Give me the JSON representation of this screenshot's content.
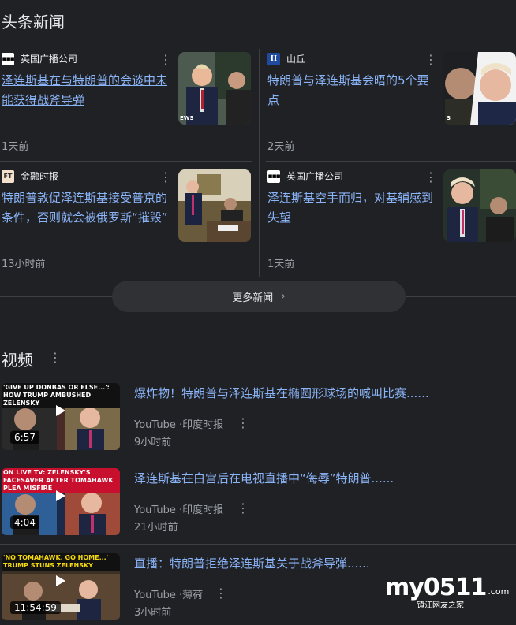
{
  "top_news": {
    "title": "头条新闻",
    "cards": [
      {
        "source": "英国广播公司",
        "favicon": "bbc-icon",
        "title": "泽连斯基在与特朗普的会谈中未能获得战斧导弹",
        "time": "1天前",
        "thumb_label": "EWS"
      },
      {
        "source": "山丘",
        "favicon": "the-hill-icon",
        "title": "特朗普与泽连斯基会晤的5个要点",
        "time": "2天前",
        "thumb_label": "S"
      },
      {
        "source": "金融时报",
        "favicon": "ft-icon",
        "favicon_text": "FT",
        "title": "特朗普敦促泽连斯基接受普京的条件，否则就会被俄罗斯“摧毁”",
        "time": "13小时前"
      },
      {
        "source": "英国广播公司",
        "favicon": "bbc-icon",
        "title": "泽连斯基空手而归，对基辅感到失望",
        "time": "1天前"
      }
    ],
    "more_label": "更多新闻"
  },
  "videos": {
    "title": "视频",
    "items": [
      {
        "title": "爆炸物！特朗普与泽连斯基在椭圆形球场的喊叫比赛......",
        "source": "YouTube",
        "channel": "印度时报",
        "time": "9小时前",
        "duration": "6:57",
        "banner": "'GIVE UP DONBAS OR ELSE...': HOW TRUMP AMBUSHED ZELENSKY"
      },
      {
        "title": "泽连斯基在白宫后在电视直播中“侮辱”特朗普......",
        "source": "YouTube",
        "channel": "印度时报",
        "time": "21小时前",
        "duration": "4:04",
        "banner": "ON LIVE TV: ZELENSKY'S FACESAVER AFTER TOMAHAWK PLEA MISFIRE"
      },
      {
        "title": "直播：特朗普拒绝泽连斯基关于战斧导弹......",
        "source": "YouTube",
        "channel": "薄荷",
        "time": "3小时前",
        "duration": "11:54:59",
        "banner": "'NO TOMAHAWK, GO HOME...' TRUMP STUNS ZELENSKY"
      }
    ],
    "separator": " ·"
  },
  "watermark": {
    "brand": "my0511",
    "domain": ".com",
    "tagline": "镇江网友之家"
  },
  "colors": {
    "background": "#202124",
    "link": "#8ab4f8",
    "muted": "#9aa0a6",
    "divider": "#3c4043"
  }
}
